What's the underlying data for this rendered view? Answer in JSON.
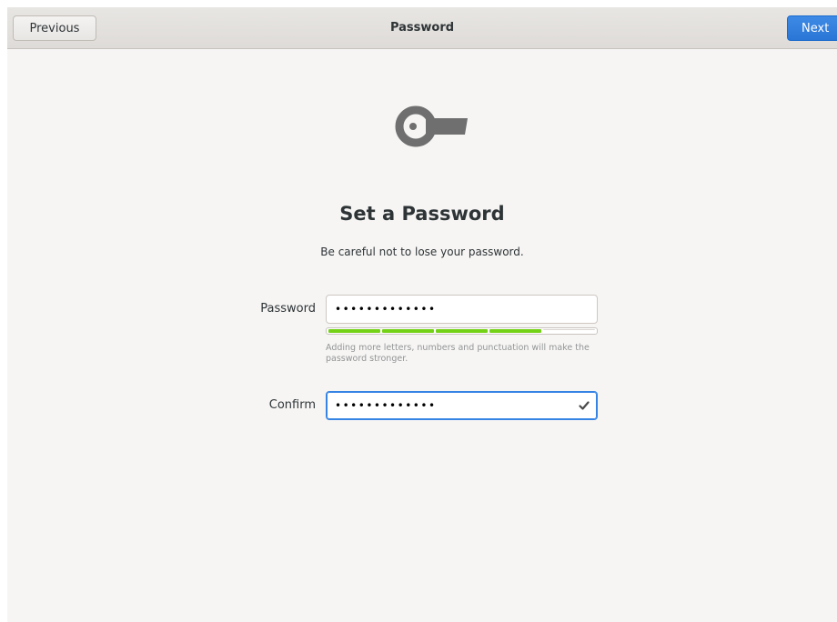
{
  "header": {
    "title": "Password",
    "previous_label": "Previous",
    "next_label": "Next"
  },
  "page": {
    "icon": "key-icon",
    "title": "Set a Password",
    "subtitle": "Be careful not to lose your password."
  },
  "form": {
    "password": {
      "label": "Password",
      "value": "•••••••••••••"
    },
    "strength": {
      "level": 0.8,
      "segments": 5,
      "filled_segments": 4,
      "hint": "Adding more letters, numbers and punctuation will make the password stronger."
    },
    "confirm": {
      "label": "Confirm",
      "value": "•••••••••••••",
      "status_icon": "checkmark-icon"
    }
  },
  "colors": {
    "accent": "#3584e4",
    "strength_fill": "#73d216",
    "background": "#f6f5f4",
    "icon_gray": "#6f6f6f"
  }
}
